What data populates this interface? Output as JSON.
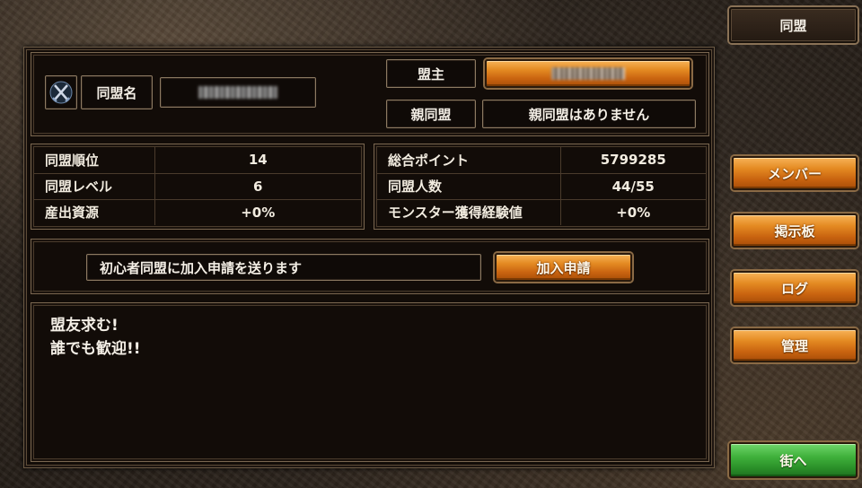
{
  "side_menu": {
    "title": "同盟",
    "members": "メンバー",
    "board": "掲示板",
    "log": "ログ",
    "manage": "管理",
    "to_town": "街へ"
  },
  "alliance": {
    "name_label": "同盟名",
    "leader_label": "盟主",
    "parent_label": "親同盟",
    "parent_value": "親同盟はありません"
  },
  "stats_left": [
    {
      "label": "同盟順位",
      "value": "14"
    },
    {
      "label": "同盟レベル",
      "value": "6"
    },
    {
      "label": "産出資源",
      "value": "+0%"
    }
  ],
  "stats_right": [
    {
      "label": "総合ポイント",
      "value": "5799285"
    },
    {
      "label": "同盟人数",
      "value": "44/55"
    },
    {
      "label": "モンスター獲得経験値",
      "value": "+0%"
    }
  ],
  "join": {
    "text": "初心者同盟に加入申請を送ります",
    "button": "加入申請"
  },
  "message": {
    "line1": "盟友求む!",
    "line2": "誰でも歓迎!!"
  },
  "colors": {
    "orange_button": "#e48a22",
    "green_button": "#3fb03b",
    "panel_bg": "#120c08"
  }
}
